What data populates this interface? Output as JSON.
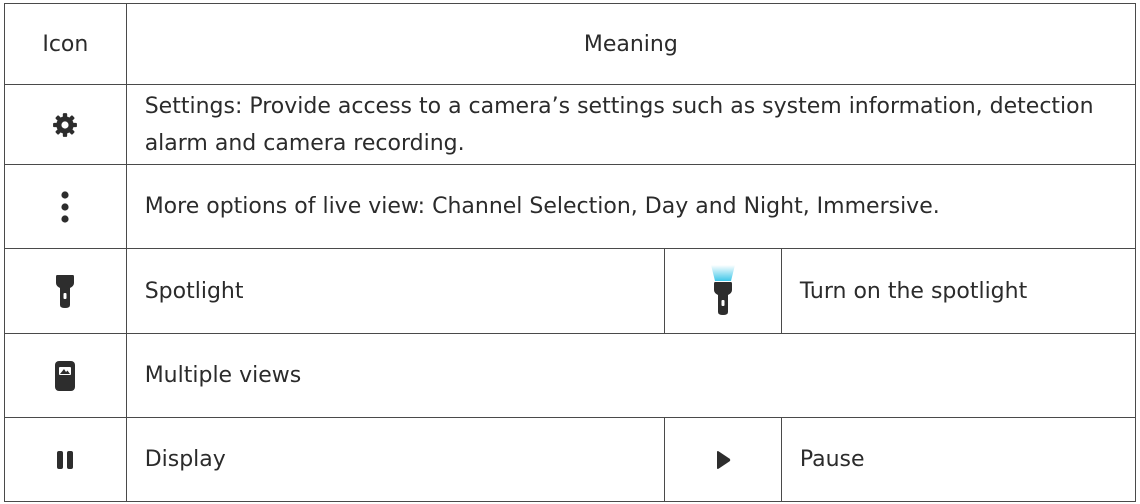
{
  "table": {
    "header": {
      "icon": "Icon",
      "meaning": "Meaning"
    },
    "rows": [
      {
        "icon": "gear-icon",
        "meaning": "Settings: Provide access to a camera’s settings such as system information, detection alarm and camera recording."
      },
      {
        "icon": "more-vertical-icon",
        "meaning": "More options of live view: Channel Selection, Day and Night, Immersive."
      },
      {
        "icon": "spotlight-icon",
        "meaning": "Spotlight",
        "icon2": "spotlight-on-icon",
        "meaning2": "Turn on the spotlight"
      },
      {
        "icon": "multiple-views-icon",
        "meaning": "Multiple views"
      },
      {
        "icon": "pause-icon",
        "meaning": "Display",
        "icon2": "play-icon",
        "meaning2": "Pause"
      }
    ]
  },
  "colors": {
    "icon": "#2d2d2d",
    "spotlight_glow": "#35c4e8",
    "border": "#4a4a4a"
  }
}
